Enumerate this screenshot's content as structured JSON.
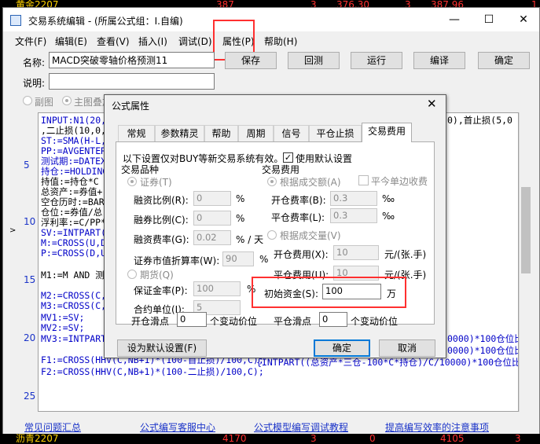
{
  "bg_quotes": {
    "top": {
      "name": "黄金2207",
      "v1": "387",
      "v2": "3",
      "v3": "376.30",
      "v4": "3",
      "v5": "387.96",
      "v6": "1"
    },
    "bottom": {
      "name": "沥青2207",
      "v1": "4170",
      "v2": "3",
      "v3": "0",
      "v4": "4105",
      "v5": "3"
    }
  },
  "window": {
    "title": "交易系统编辑 - (所属公式组：I.自编)",
    "min_glyph": "—",
    "max_glyph": "☐",
    "close_glyph": "✕"
  },
  "menu": [
    "文件(F)",
    "编辑(E)",
    "查看(V)",
    "插入(I)",
    "调试(D)",
    "属性(P)",
    "帮助(H)"
  ],
  "toolbar": {
    "name_label": "名称:",
    "name_value": "MACD突破零轴价格预测11",
    "desc_label": "说明:",
    "desc_value": "",
    "buttons": [
      "保存",
      "回测",
      "运行",
      "编译",
      "确定"
    ],
    "radio_labels": [
      "副图",
      "主图叠加"
    ]
  },
  "code": {
    "line_numbers": [
      "5",
      "10",
      "15",
      "20",
      "25"
    ],
    "lines": [
      "INPUT:N1(20,1",
      ",二止损(10,0,",
      "ST:=SMA(H-L,2",
      "PP:=AVGENTERE",
      "测试期:=DATEX",
      "持仓:=HOLDING",
      "持值:=持仓*C",
      "总资产:=券值+",
      "空仓历时:=BAR",
      "仓位:=券值/总",
      "浮利率:=C/PP*",
      "SV:=INTPART(总",
      "M:=CROSS(U,D)",
      "P:=CROSS(D,U)",
      "",
      "M1:=M AND 测试",
      "",
      "M2:=CROSS(C,R",
      "M3:=CROSS(C,R",
      "MV1:=SV;",
      "MV2:=SV;",
      "MV3:=INTPART(CASH(0)/C/100)*100;",
      "",
      "F1:=CROSS(HHV(C,NB+1)*(100-首止损)/100,C);",
      "F2:=CROSS(HHV(C,NB+1)*(100-二止损)/100,C);"
    ],
    "right_fragments": [
      "0),首止损(5,0",
      "0000)*100仓位比",
      "0000)*100仓位比",
      "{INTPART((总资产*三仓-100*C*持仓)/C/10000)*100仓位比例"
    ]
  },
  "links": [
    "常见问题汇总",
    "公式编写客服中心",
    "公式模型编写调试教程",
    "提高编写效率的注意事项"
  ],
  "dialog": {
    "title": "公式属性",
    "close_glyph": "✕",
    "tabs": [
      "常规",
      "参数精灵",
      "帮助",
      "周期",
      "信号",
      "平仓止损",
      "交易费用"
    ],
    "active_tab": "交易费用",
    "notice": "以下设置仅对BUY等新交易系统有效。",
    "use_default_label": "使用默认设置",
    "use_default_checked": true,
    "group_variety": "交易品种",
    "radio_stock": "证券(T)",
    "margin_ratio_label": "融资比例(R):",
    "margin_ratio_value": "0",
    "short_ratio_label": "融券比例(C):",
    "short_ratio_value": "0",
    "financing_fee_label": "融资费率(G):",
    "financing_fee_value": "0.02",
    "financing_fee_unit": "% / 天",
    "market_value_rate_label": "证券市值折算率(W):",
    "market_value_rate_value": "90",
    "radio_futures": "期货(Q)",
    "deposit_label": "保证金率(P):",
    "deposit_value": "100",
    "contract_unit_label": "合约单位(I):",
    "contract_unit_value": "5",
    "percent": "%",
    "group_fee": "交易费用",
    "radio_by_amount": "根据成交额(A)",
    "single_side_label": "平今单边收费",
    "open_rate_label": "开仓费率(B):",
    "open_rate_value": "0.3",
    "close_rate_label": "平仓费率(L):",
    "close_rate_value": "0.3",
    "permille": "‰",
    "radio_by_volume": "根据成交量(V)",
    "open_fee_label": "开仓费用(X):",
    "open_fee_value": "10",
    "close_fee_label": "平仓费用(U):",
    "close_fee_value": "10",
    "per_lot": "元/(张.手)",
    "initial_capital_label": "初始资金(S):",
    "initial_capital_value": "100",
    "initial_capital_unit": "万",
    "open_slip_label": "开仓滑点",
    "open_slip_value": "0",
    "close_slip_label": "平仓滑点",
    "close_slip_value": "0",
    "slip_unit": "个变动价位",
    "set_default_button": "设为默认设置(F)",
    "ok_button": "确定",
    "cancel_button": "取消"
  }
}
